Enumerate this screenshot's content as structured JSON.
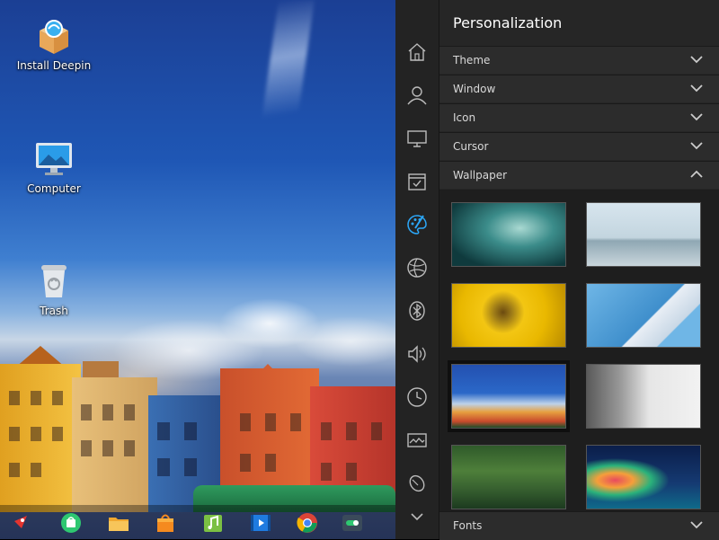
{
  "desktop": {
    "icons": [
      {
        "label": "Install Deepin",
        "icon": "install-box-icon"
      },
      {
        "label": "Computer",
        "icon": "computer-monitor-icon"
      },
      {
        "label": "Trash",
        "icon": "trash-bin-icon"
      }
    ]
  },
  "dock": {
    "items": [
      {
        "icon": "launcher-rocket-icon"
      },
      {
        "icon": "store-bag-icon"
      },
      {
        "icon": "file-manager-icon"
      },
      {
        "icon": "shopping-bag-icon"
      },
      {
        "icon": "music-icon"
      },
      {
        "icon": "video-player-icon"
      },
      {
        "icon": "chrome-browser-icon"
      },
      {
        "icon": "toggle-settings-icon"
      }
    ]
  },
  "control_center": {
    "title": "Personalization",
    "nav": [
      {
        "icon": "home-icon",
        "active": false
      },
      {
        "icon": "user-icon",
        "active": false
      },
      {
        "icon": "display-icon",
        "active": false
      },
      {
        "icon": "calendar-check-icon",
        "active": false
      },
      {
        "icon": "palette-icon",
        "active": true
      },
      {
        "icon": "globe-icon",
        "active": false
      },
      {
        "icon": "bluetooth-icon",
        "active": false
      },
      {
        "icon": "speaker-icon",
        "active": false
      },
      {
        "icon": "clock-icon",
        "active": false
      },
      {
        "icon": "image-broken-icon",
        "active": false
      },
      {
        "icon": "mouse-icon",
        "active": false
      },
      {
        "icon": "chevron-down-icon",
        "active": false
      }
    ],
    "sections": [
      {
        "label": "Theme",
        "expanded": false
      },
      {
        "label": "Window",
        "expanded": false
      },
      {
        "label": "Icon",
        "expanded": false
      },
      {
        "label": "Cursor",
        "expanded": false
      },
      {
        "label": "Wallpaper",
        "expanded": true
      }
    ],
    "footer_section": {
      "label": "Fonts",
      "expanded": false
    },
    "wallpapers": [
      {
        "name": "teal-cave",
        "selected": false
      },
      {
        "name": "bridge-birds",
        "selected": false
      },
      {
        "name": "sunflower",
        "selected": false
      },
      {
        "name": "building-sky",
        "selected": false
      },
      {
        "name": "city-blue-sky",
        "selected": true
      },
      {
        "name": "misty-cliff",
        "selected": false
      },
      {
        "name": "forest-pond",
        "selected": false
      },
      {
        "name": "colorful-trees-night",
        "selected": false
      }
    ],
    "colors": {
      "accent": "#2ca7f8",
      "panel": "#262626",
      "rail": "#232323"
    }
  }
}
